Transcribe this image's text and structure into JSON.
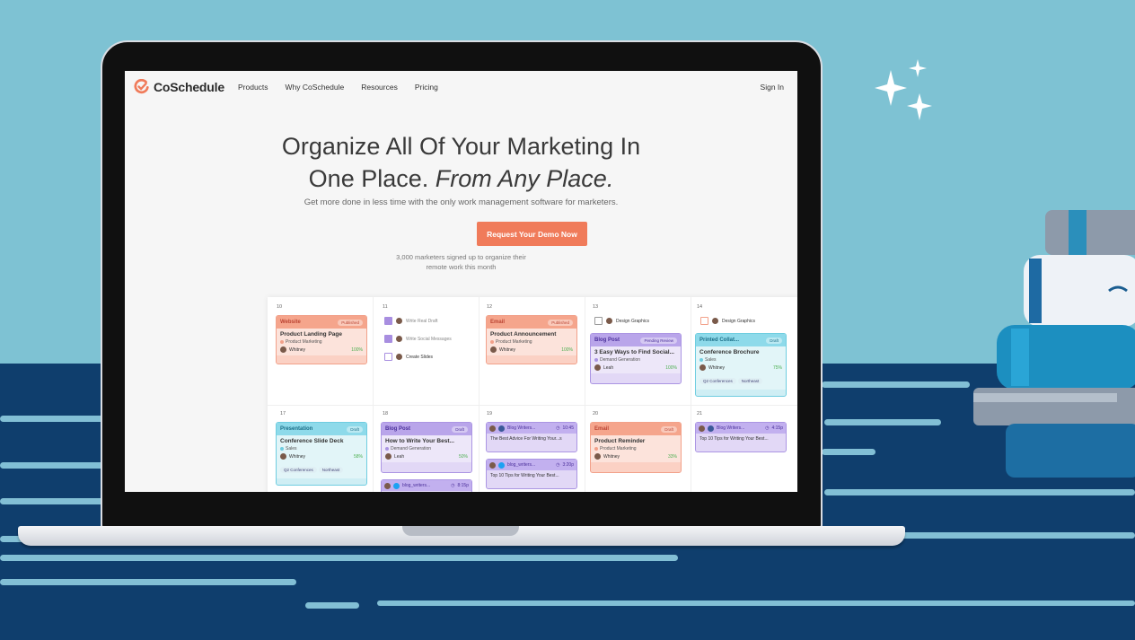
{
  "brand": {
    "name": "CoSchedule",
    "accent": "#f07b5a"
  },
  "nav": {
    "links": [
      "Products",
      "Why CoSchedule",
      "Resources",
      "Pricing"
    ],
    "signin": "Sign In"
  },
  "hero": {
    "title_line1": "Organize All Of Your Marketing In",
    "title_line2_plain": "One Place.",
    "title_line2_italic": "From Any Place.",
    "subtitle": "Get more done in less time with the only work management software for marketers.",
    "cta": "Request Your Demo Now",
    "social_proof_line1": "3,000 marketers signed up to organize their",
    "social_proof_line2": "remote work this month"
  },
  "calendar": {
    "days_row1": [
      "10",
      "11",
      "12",
      "13",
      "14"
    ],
    "days_row2": [
      "17",
      "18",
      "19",
      "20",
      "21"
    ],
    "c10": {
      "type": "Website",
      "status": "Published",
      "title": "Product Landing Page",
      "category": "Product Marketing",
      "owner": "Whitney",
      "pct": "100%"
    },
    "tasks11": [
      "Write Real Draft",
      "Write Social Messages",
      "Create Slides"
    ],
    "c12": {
      "type": "Email",
      "status": "Published",
      "title": "Product Announcement",
      "category": "Product Marketing",
      "owner": "Whitney",
      "pct": "100%"
    },
    "task13": "Design Graphics",
    "c13": {
      "type": "Blog Post",
      "status": "Pending Review",
      "title": "3 Easy Ways to Find Social...",
      "category": "Demand Generation",
      "owner": "Leah",
      "pct": "100%"
    },
    "task14": "Design Graphics",
    "c14": {
      "type": "Printed Collat...",
      "status": "Draft",
      "title": "Conference Brochure",
      "category": "Sales",
      "owner": "Whitney",
      "pct": "75%",
      "chips": [
        "Q2 Conferences",
        "Northeast"
      ]
    },
    "c17": {
      "type": "Presentation",
      "status": "Draft",
      "title": "Conference Slide Deck",
      "category": "Sales",
      "owner": "Whitney",
      "pct": "58%",
      "chips": [
        "Q2 Conferences",
        "Northeast"
      ]
    },
    "c18": {
      "type": "Blog Post",
      "status": "Draft",
      "title": "How to Write Your Best...",
      "category": "Demand Generation",
      "owner": "Leah",
      "pct": "50%"
    },
    "c18b": {
      "handle": "blog_writers...",
      "time": "8:15p"
    },
    "s19a": {
      "handle": "Blog Writers...",
      "time": "10:45",
      "text": "The Best Advice For Writing Your...s"
    },
    "s19b": {
      "handle": "blog_writers...",
      "time": "3:20p",
      "text": "Top 10 Tips for Writing Your Best..."
    },
    "c20": {
      "type": "Email",
      "status": "Draft",
      "title": "Product Reminder",
      "category": "Product Marketing",
      "owner": "Whitney",
      "pct": "33%"
    },
    "s21": {
      "handle": "Blog Writers...",
      "time": "4:15p",
      "text": "Top 10 Tips for Writing Your Best..."
    }
  }
}
